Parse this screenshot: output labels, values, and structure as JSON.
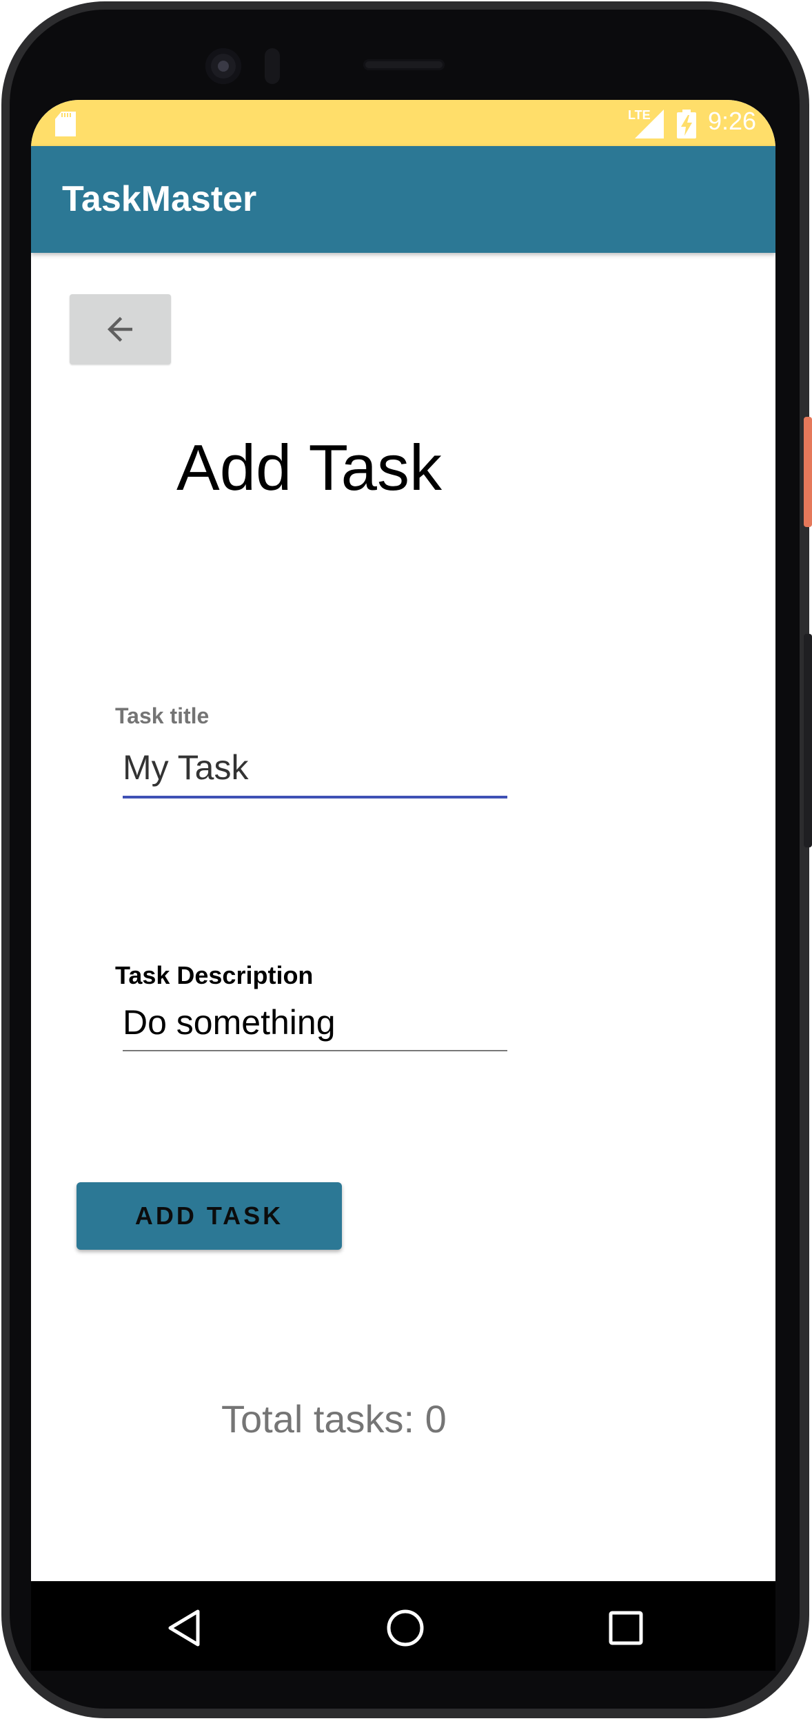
{
  "status_bar": {
    "network_label": "LTE",
    "time": "9:26"
  },
  "app_bar": {
    "title": "TaskMaster"
  },
  "back_button": {
    "icon": "arrow-left-icon"
  },
  "page": {
    "title": "Add Task"
  },
  "task_title_field": {
    "label": "Task title",
    "value": "My Task"
  },
  "task_description_field": {
    "label": "Task Description",
    "value": "Do something"
  },
  "add_button": {
    "label": "ADD TASK"
  },
  "footer": {
    "total_tasks": "Total tasks: 0"
  },
  "nav_bar": {
    "icons": [
      "nav-back-icon",
      "nav-home-icon",
      "nav-recents-icon"
    ]
  },
  "colors": {
    "status_bar": "#ffde6a",
    "primary": "#2c7895",
    "input_focus": "#3f51b5",
    "back_button_bg": "#d6d7d7"
  }
}
